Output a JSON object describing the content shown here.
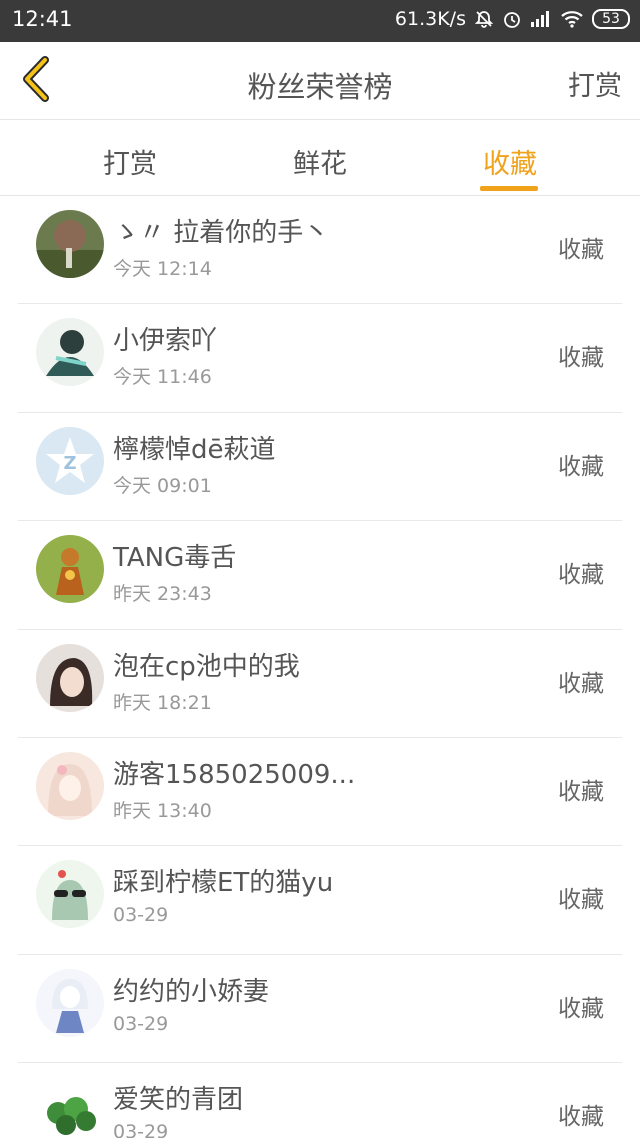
{
  "status_bar": {
    "time": "12:41",
    "net_speed": "61.3K/s",
    "battery": "53"
  },
  "nav": {
    "title": "粉丝荣誉榜",
    "action": "打赏"
  },
  "tabs": [
    {
      "label": "打赏",
      "active": false
    },
    {
      "label": "鲜花",
      "active": false
    },
    {
      "label": "收藏",
      "active": true
    }
  ],
  "colors": {
    "accent": "#f0a21b",
    "status_bar": "#3a3a3a"
  },
  "list": [
    {
      "name": "ゝ〃 拉着你的手丶",
      "time": "今天 12:14",
      "action": "收藏"
    },
    {
      "name": "小伊索吖",
      "time": "今天 11:46",
      "action": "收藏"
    },
    {
      "name": "檸檬悼dē萩道",
      "time": "今天 09:01",
      "action": "收藏"
    },
    {
      "name": "TANG毒舌",
      "time": "昨天 23:43",
      "action": "收藏"
    },
    {
      "name": "泡在cp池中的我",
      "time": "昨天 18:21",
      "action": "收藏"
    },
    {
      "name": "游客1585025009...",
      "time": "昨天 13:40",
      "action": "收藏"
    },
    {
      "name": "踩到柠檬ET的猫yu",
      "time": "03-29",
      "action": "收藏"
    },
    {
      "name": "约约的小娇妻",
      "time": "03-29",
      "action": "收藏"
    },
    {
      "name": "爱笑的青团",
      "time": "03-29",
      "action": "收藏"
    }
  ]
}
